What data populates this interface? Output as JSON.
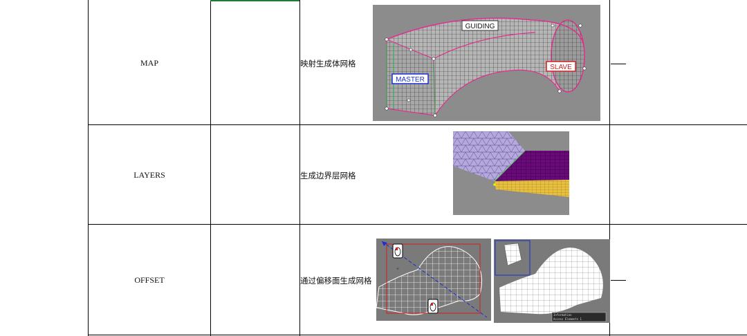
{
  "rows": [
    {
      "name": "MAP",
      "desc": "映射生成体网格",
      "note": "—",
      "labels": {
        "guiding": "GUIDING",
        "master": "MASTER",
        "slave": "SLAVE"
      }
    },
    {
      "name": "LAYERS",
      "desc": "生成边界层网格",
      "note": ""
    },
    {
      "name": "OFFSET",
      "desc": "通过偏移面生成网格",
      "note": "—",
      "console": {
        "line1": "Information",
        "line2": "Access Elements 1"
      }
    }
  ],
  "colors": {
    "grid_bg": "#8c8c8c",
    "mesh_line": "#2a2a2a",
    "edge_magenta": "#e0308c",
    "layer_purple": "#6a0a7a",
    "layer_yellow": "#e8c040",
    "offset_bg": "#7a7a7a"
  }
}
